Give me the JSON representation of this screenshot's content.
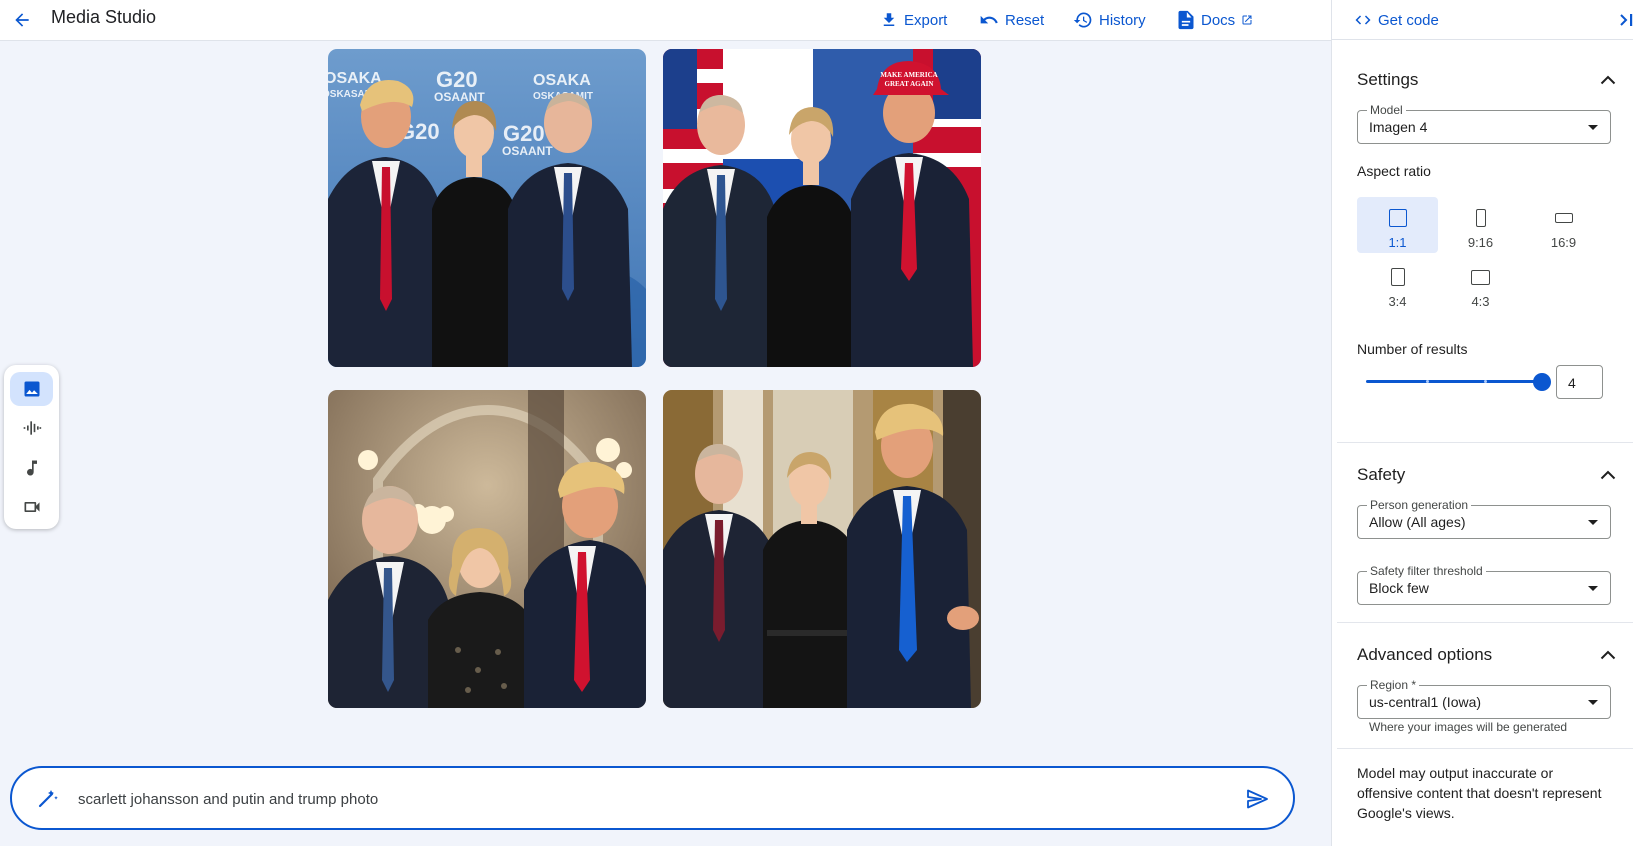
{
  "header": {
    "title": "Media Studio",
    "export_label": "Export",
    "reset_label": "Reset",
    "history_label": "History",
    "docs_label": "Docs"
  },
  "panel": {
    "get_code_label": "Get code",
    "settings": {
      "title": "Settings",
      "model_label": "Model",
      "model_value": "Imagen 4",
      "aspect_ratio_title": "Aspect ratio",
      "aspect_ratios": [
        "1:1",
        "9:16",
        "16:9",
        "3:4",
        "4:3"
      ],
      "aspect_ratio_selected": "1:1",
      "results_title": "Number of results",
      "results_value": "4",
      "results_fraction": 1.0
    },
    "safety": {
      "title": "Safety",
      "person_label": "Person generation",
      "person_value": "Allow (All ages)",
      "filter_label": "Safety filter threshold",
      "filter_value": "Block few"
    },
    "advanced": {
      "title": "Advanced options",
      "region_label": "Region *",
      "region_value": "us-central1 (Iowa)",
      "region_helper": "Where your images will be generated"
    },
    "disclaimer": "Model may output inaccurate or offensive content that doesn't represent Google's views."
  },
  "sidebar_tools": [
    "image-tool",
    "speech-tool",
    "music-tool",
    "video-tool"
  ],
  "prompt": {
    "value": "scarlett johansson and putin and trump photo"
  },
  "images": {
    "img1_sign_a": "OSAKA",
    "img1_sign_b": "G20",
    "img1_sign_c": "OSAANT",
    "img1_sign_d": "OSKASAMIT",
    "img1_sign_e": "OSAANT",
    "img1_sign_f": "OSAKA",
    "img1_sign_g": "OSKASAMIT",
    "img1_sign_h": "G20",
    "img1_sign_i": "G20",
    "img2_hat_a": "MAKE AMERICA",
    "img2_hat_b": "GREAT AGAIN"
  },
  "colors": {
    "accent": "#0b57d0",
    "selected_bg": "#e3ebfb",
    "page_bg": "#f1f4fb"
  }
}
